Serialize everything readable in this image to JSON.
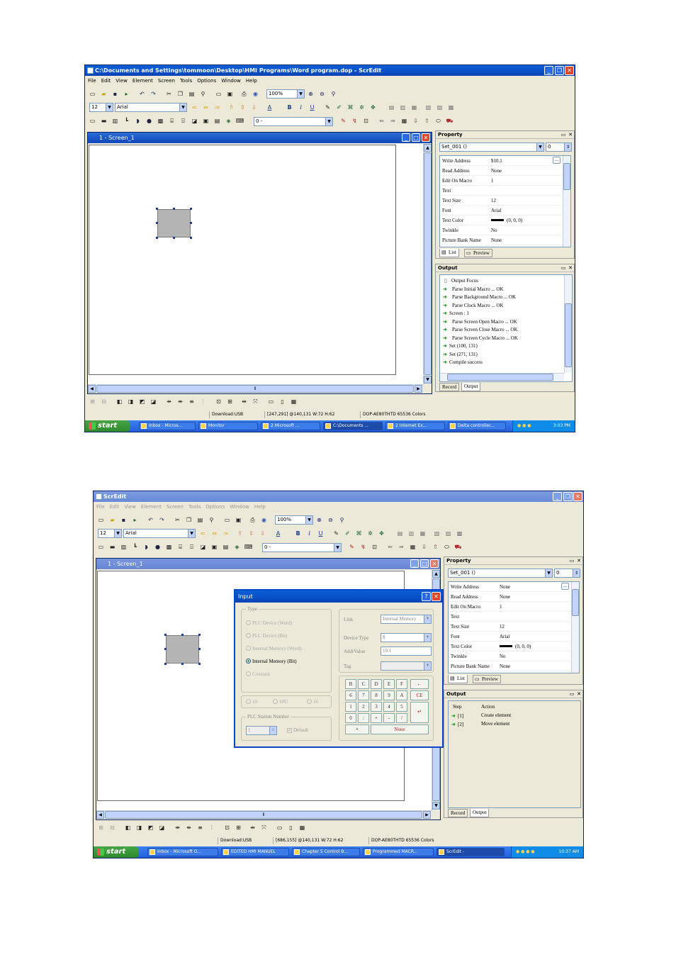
{
  "w1": {
    "title": "C:\\Documents and Settings\\tommoon\\Desktop\\HMI Programs\\Word program.dop - ScrEdit",
    "menu": [
      "File",
      "Edit",
      "View",
      "Element",
      "Screen",
      "Tools",
      "Options",
      "Window",
      "Help"
    ],
    "zoom": "100%",
    "font_size": "12",
    "font_name": "Arial",
    "device_combo": "0 -",
    "child_title": "1 - Screen_1",
    "property": {
      "header": "Property",
      "object": "Set_001 ()",
      "spin": "0",
      "rows": [
        {
          "k": "Write Address",
          "v": "$10.1"
        },
        {
          "k": "Read Address",
          "v": "None"
        },
        {
          "k": "Edit On Macro",
          "v": "1"
        },
        {
          "k": "Text",
          "v": ""
        },
        {
          "k": "Text Size",
          "v": "12"
        },
        {
          "k": "Font",
          "v": "Arial"
        },
        {
          "k": "Text Color",
          "v": "(0, 0, 0)"
        },
        {
          "k": "Twinkle",
          "v": "No"
        },
        {
          "k": "Picture Bank Name",
          "v": "None"
        }
      ],
      "tabs": [
        "List",
        "Preview"
      ]
    },
    "output": {
      "header": "Output",
      "lines": [
        "Output Focus",
        "Parse Initial Macro ... OK",
        "Parse Background Macro ... OK",
        "Parse Clock Macro ... OK",
        "Screen : 1",
        "Parse Screen Open Macro ... OK",
        "Parse Screen Close Macro ... OK",
        "Parse Screen Cycle Macro ... OK",
        "Set (100, 131)",
        "Set (271, 131)",
        "Compile success"
      ],
      "tabs": [
        "Record",
        "Output"
      ]
    },
    "status": [
      "Download:USB",
      "[247,291] @140,131 W:72 H:62",
      "DOP-AE80THTD 65536 Colors"
    ],
    "taskbar": {
      "start": "start",
      "tasks": [
        "Inbox - Micros...",
        "Monitor",
        "2 Microsoft ...",
        "C:\\Documents ...",
        "2 Internet Ex...",
        "Delta controller..."
      ],
      "clock": "3:03 PM"
    }
  },
  "w2": {
    "title": "ScrEdit",
    "menu": [
      "File",
      "Edit",
      "View",
      "Element",
      "Screen",
      "Tools",
      "Options",
      "Window",
      "Help"
    ],
    "zoom": "100%",
    "font_size": "12",
    "font_name": "Arial",
    "device_combo": "0 -",
    "child_title": "1 - Screen_1",
    "property": {
      "header": "Property",
      "object": "Set_001 ()",
      "spin": "0",
      "rows": [
        {
          "k": "Write Address",
          "v": "None"
        },
        {
          "k": "Read Address",
          "v": "None"
        },
        {
          "k": "Edit On Macro",
          "v": "1"
        },
        {
          "k": "Text",
          "v": ""
        },
        {
          "k": "Text Size",
          "v": "12"
        },
        {
          "k": "Font",
          "v": "Arial"
        },
        {
          "k": "Text Color",
          "v": "(0, 0, 0)"
        },
        {
          "k": "Twinkle",
          "v": "No"
        },
        {
          "k": "Picture Bank Name",
          "v": "None"
        }
      ],
      "tabs": [
        "List",
        "Preview"
      ]
    },
    "output": {
      "header": "Output",
      "col_step": "Step",
      "col_action": "Action",
      "rows": [
        {
          "step": "[1]",
          "action": "Create element"
        },
        {
          "step": "[2]",
          "action": "Move element"
        }
      ],
      "tabs": [
        "Record",
        "Output"
      ]
    },
    "dialog": {
      "title": "Input",
      "type_group": "Type",
      "types": [
        "PLC Device (Word)",
        "PLC Device (Bit)",
        "Internal Memory (Word)",
        "Internal Memory (Bit)",
        "Constant"
      ],
      "bases": [
        "10",
        "10U",
        "16"
      ],
      "station_group": "PLC Station Number",
      "station_value": "1",
      "default_label": "Default",
      "link_label": "Link",
      "link_value": "Internal Memory",
      "device_type_label": "Device Type",
      "device_type_value": "$",
      "addr_label": "AddrValue",
      "addr_value": "10.1",
      "tag_label": "Tag",
      "keys": [
        "B",
        "C",
        "D",
        "E",
        "F",
        "←",
        "6",
        "7",
        "8",
        "9",
        "A",
        "CE",
        "1",
        "2",
        "3",
        "4",
        "5",
        "0",
        ":",
        "+",
        "-",
        "/",
        "•",
        "None"
      ]
    },
    "status": [
      "Download:USB",
      "[686,155] @140,131 W:72 H:62",
      "DOP-AE80THTD 65536 Colors"
    ],
    "taskbar": {
      "start": "start",
      "tasks": [
        "Inbox - Microsoft O...",
        "EDITED HMI MANUEL",
        "Chapter 5 Control B...",
        "Programmed MACR...",
        "ScrEdit -"
      ],
      "clock": "10:37 AM"
    }
  }
}
